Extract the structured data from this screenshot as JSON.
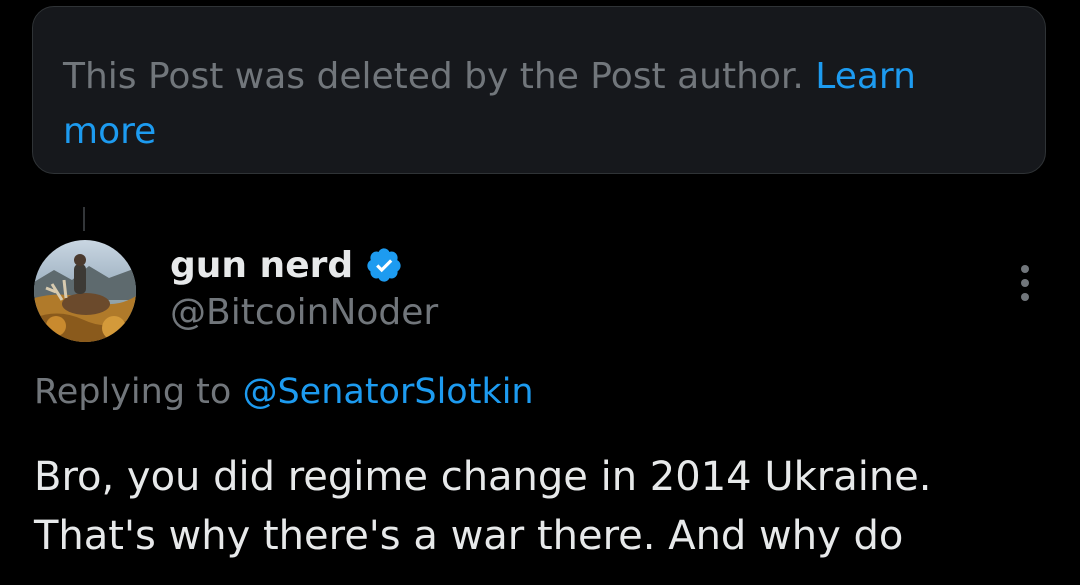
{
  "deleted_notice": {
    "text": "This Post was deleted by the Post author. ",
    "link_label": "Learn more"
  },
  "post": {
    "author": {
      "display_name": "gun nerd",
      "handle": "@BitcoinNoder",
      "verified": true
    },
    "replying_prefix": "Replying to ",
    "replying_to": "@SenatorSlotkin",
    "text_lines": [
      "Bro, you did regime change in 2014 Ukraine.",
      "That's why there's a war there. And why do"
    ]
  },
  "colors": {
    "background": "#000000",
    "card_background": "#16181c",
    "muted_text": "#71767b",
    "primary_text": "#e7e9ea",
    "link": "#1d9bf0"
  },
  "icons": {
    "verified": "verified-badge-icon",
    "more": "more-options-icon"
  }
}
